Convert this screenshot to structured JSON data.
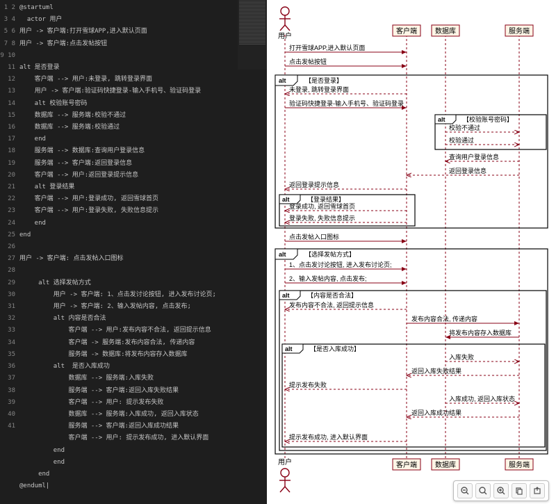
{
  "editor": {
    "lines": [
      "@startuml",
      "  actor 用户",
      "用户 -> 客户端:打开雪球APP,进入默认页面",
      "用户 -> 客户端:点击发帖按钮",
      "",
      "alt 是否登录",
      "    客户端 --> 用户:未登录, 跳转登录界面",
      "    用户 -> 客户端:验证码快捷登录-输入手机号、验证码登录",
      "    alt 校验账号密码",
      "    数据库 --> 服务端:校验不通过",
      "    数据库 --> 服务端:校验通过",
      "    end",
      "    服务端 --> 数据库:查询用户登录信息",
      "    服务端 --> 客户端:返回登录信息",
      "    客户端 --> 用户:返回登录提示信息",
      "    alt 登录结果",
      "    客户端 --> 用户:登录成功, 返回雪球首页",
      "    客户端 --> 用户:登录失败, 失败信息提示",
      "    end",
      "end",
      "",
      "用户 -> 客户端: 点击发帖入口图标",
      "",
      "     alt 选择发帖方式",
      "         用户 -> 客户端: 1、点击发讨论按钮, 进入发布讨论页;",
      "         用户 -> 客户端: 2、输入发帖内容, 点击发布;",
      "         alt 内容是否合法",
      "             客户端 --> 用户:发布内容不合法, 返回提示信息",
      "             客户端 -> 服务端:发布内容合法, 传递内容",
      "             服务端 -> 数据库:将发布内容存入数据库",
      "         alt  是否入库成功",
      "             数据库 --> 服务端:入库失败",
      "             服务端 --> 客户端:返回入库失败结果",
      "             客户端 --> 用户: 提示发布失败",
      "             数据库 --> 服务端:入库成功, 返回入库状态",
      "             服务端 --> 客户端:返回入库成功结果",
      "             客户端 --> 用户: 提示发布成功, 进入默认界面",
      "         end",
      "         end",
      "     end",
      "@enduml|"
    ]
  },
  "chart_data": {
    "type": "sequence-diagram",
    "actors": [
      "用户",
      "客户端",
      "数据库",
      "服务端"
    ],
    "messages": [
      {
        "from": "用户",
        "to": "客户端",
        "label": "打开雪球APP,进入默认页面"
      },
      {
        "from": "用户",
        "to": "客户端",
        "label": "点击发帖按钮"
      },
      {
        "alt": "是否登录",
        "messages": [
          {
            "from": "客户端",
            "to": "用户",
            "label": "未登录, 跳转登录界面",
            "dashed": true
          },
          {
            "from": "用户",
            "to": "客户端",
            "label": "验证码快捷登录-输入手机号、验证码登录"
          },
          {
            "alt": "校验账号密码",
            "messages": [
              {
                "from": "数据库",
                "to": "服务端",
                "label": "校验不通过",
                "dashed": true
              },
              {
                "from": "数据库",
                "to": "服务端",
                "label": "校验通过",
                "dashed": true
              }
            ]
          },
          {
            "from": "服务端",
            "to": "数据库",
            "label": "查询用户登录信息",
            "dashed": true
          },
          {
            "from": "服务端",
            "to": "客户端",
            "label": "返回登录信息",
            "dashed": true
          },
          {
            "from": "客户端",
            "to": "用户",
            "label": "返回登录提示信息",
            "dashed": true
          },
          {
            "alt": "登录结果",
            "messages": [
              {
                "from": "客户端",
                "to": "用户",
                "label": "登录成功, 返回雪球首页",
                "dashed": true
              },
              {
                "from": "客户端",
                "to": "用户",
                "label": "登录失败, 失败信息提示",
                "dashed": true
              }
            ]
          }
        ]
      },
      {
        "from": "用户",
        "to": "客户端",
        "label": "点击发帖入口图标"
      },
      {
        "alt": "选择发帖方式",
        "messages": [
          {
            "from": "用户",
            "to": "客户端",
            "label": "1、点击发讨论按钮, 进入发布讨论页;"
          },
          {
            "from": "用户",
            "to": "客户端",
            "label": "2、输入发帖内容, 点击发布;"
          },
          {
            "alt": "内容是否合法",
            "messages": [
              {
                "from": "客户端",
                "to": "用户",
                "label": "发布内容不合法, 返回提示信息",
                "dashed": true
              },
              {
                "from": "客户端",
                "to": "服务端",
                "label": "发布内容合法, 传递内容"
              },
              {
                "from": "服务端",
                "to": "数据库",
                "label": "将发布内容存入数据库"
              },
              {
                "alt": "是否入库成功",
                "messages": [
                  {
                    "from": "数据库",
                    "to": "服务端",
                    "label": "入库失败",
                    "dashed": true
                  },
                  {
                    "from": "服务端",
                    "to": "客户端",
                    "label": "返回入库失败结果",
                    "dashed": true
                  },
                  {
                    "from": "客户端",
                    "to": "用户",
                    "label": "提示发布失败",
                    "dashed": true
                  },
                  {
                    "from": "数据库",
                    "to": "服务端",
                    "label": "入库成功, 返回入库状态",
                    "dashed": true
                  },
                  {
                    "from": "服务端",
                    "to": "客户端",
                    "label": "返回入库成功结果",
                    "dashed": true
                  },
                  {
                    "from": "客户端",
                    "to": "用户",
                    "label": "提示发布成功, 进入默认界面",
                    "dashed": true
                  }
                ]
              }
            ]
          }
        ]
      }
    ]
  },
  "diagram": {
    "actors": {
      "user": "用户",
      "client": "客户端",
      "db": "数据库",
      "server": "服务端"
    },
    "alt_keyword": "alt",
    "messages": {
      "m1": "打开雪球APP,进入默认页面",
      "m2": "点击发帖按钮",
      "alt1": "【是否登录】",
      "m3": "未登录, 跳转登录界面",
      "m4": "验证码快捷登录-输入手机号、验证码登录",
      "alt2": "【校验账号密码】",
      "m5": "校验不通过",
      "m6": "校验通过",
      "m7": "查询用户登录信息",
      "m8": "返回登录信息",
      "m9": "返回登录提示信息",
      "alt3": "【登录结果】",
      "m10": "登录成功, 返回雪球首页",
      "m11": "登录失败, 失败信息提示",
      "m12": "点击发帖入口图标",
      "alt4": "【选择发帖方式】",
      "m13": "1、点击发讨论按钮, 进入发布讨论页;",
      "m14": "2、输入发帖内容, 点击发布;",
      "alt5": "【内容是否合法】",
      "m15": "发布内容不合法, 返回提示信息",
      "m16": "发布内容合法, 传递内容",
      "m17": "将发布内容存入数据库",
      "alt6": "【是否入库成功】",
      "m18": "入库失败",
      "m19": "返回入库失败结果",
      "m20": "提示发布失败",
      "m21": "入库成功, 返回入库状态",
      "m22": "返回入库成功结果",
      "m23": "提示发布成功, 进入默认界面"
    }
  },
  "toolbar": {
    "zoom_out": "−",
    "zoom_fit": "⛶",
    "zoom_in": "+",
    "copy": "⧉",
    "export": "⇪"
  }
}
